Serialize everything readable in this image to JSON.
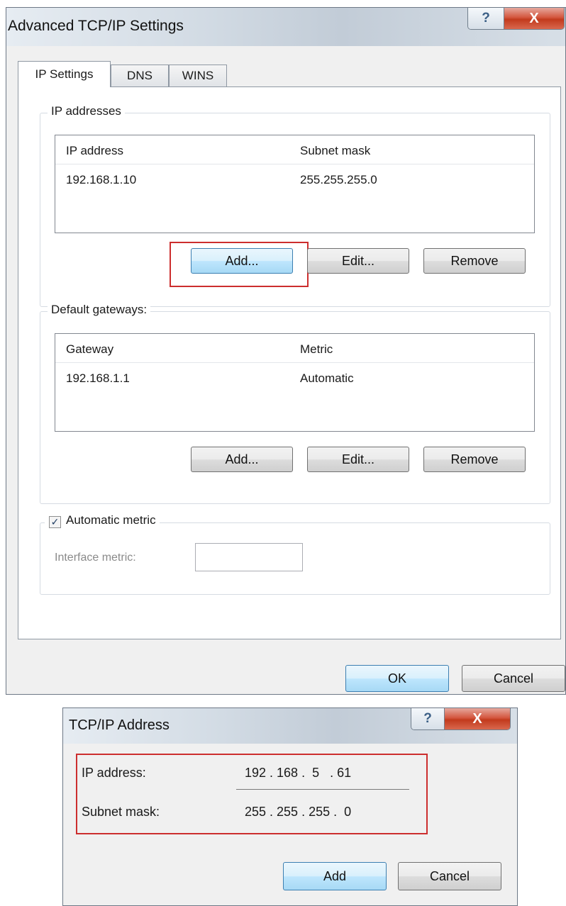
{
  "dialog1": {
    "title": "Advanced TCP/IP Settings",
    "help_glyph": "?",
    "close_glyph": "X",
    "tabs": [
      {
        "label": "IP Settings",
        "active": true
      },
      {
        "label": "DNS",
        "active": false
      },
      {
        "label": "WINS",
        "active": false
      }
    ],
    "ip_addresses": {
      "legend": "IP addresses",
      "columns": [
        "IP address",
        "Subnet mask"
      ],
      "rows": [
        [
          "192.168.1.10",
          "255.255.255.0"
        ]
      ],
      "buttons": {
        "add": "Add...",
        "edit": "Edit...",
        "remove": "Remove"
      }
    },
    "gateways": {
      "legend": "Default gateways:",
      "columns": [
        "Gateway",
        "Metric"
      ],
      "rows": [
        [
          "192.168.1.1",
          "Automatic"
        ]
      ],
      "buttons": {
        "add": "Add...",
        "edit": "Edit...",
        "remove": "Remove"
      }
    },
    "automatic_metric": {
      "label": "Automatic metric",
      "checked": true
    },
    "interface_metric": {
      "label": "Interface metric:",
      "value": ""
    },
    "ok_label": "OK",
    "cancel_label": "Cancel"
  },
  "dialog2": {
    "title": "TCP/IP Address",
    "help_glyph": "?",
    "close_glyph": "X",
    "ip_label": "IP address:",
    "ip_value": "192 . 168 .  5   . 61",
    "mask_label": "Subnet mask:",
    "mask_value": "255 . 255 . 255 .  0",
    "add_label": "Add",
    "cancel_label": "Cancel"
  },
  "colors": {
    "highlight_box": "#cc2e2e",
    "close_button": "#c23a1d",
    "focus_button": "#bee6fd"
  }
}
